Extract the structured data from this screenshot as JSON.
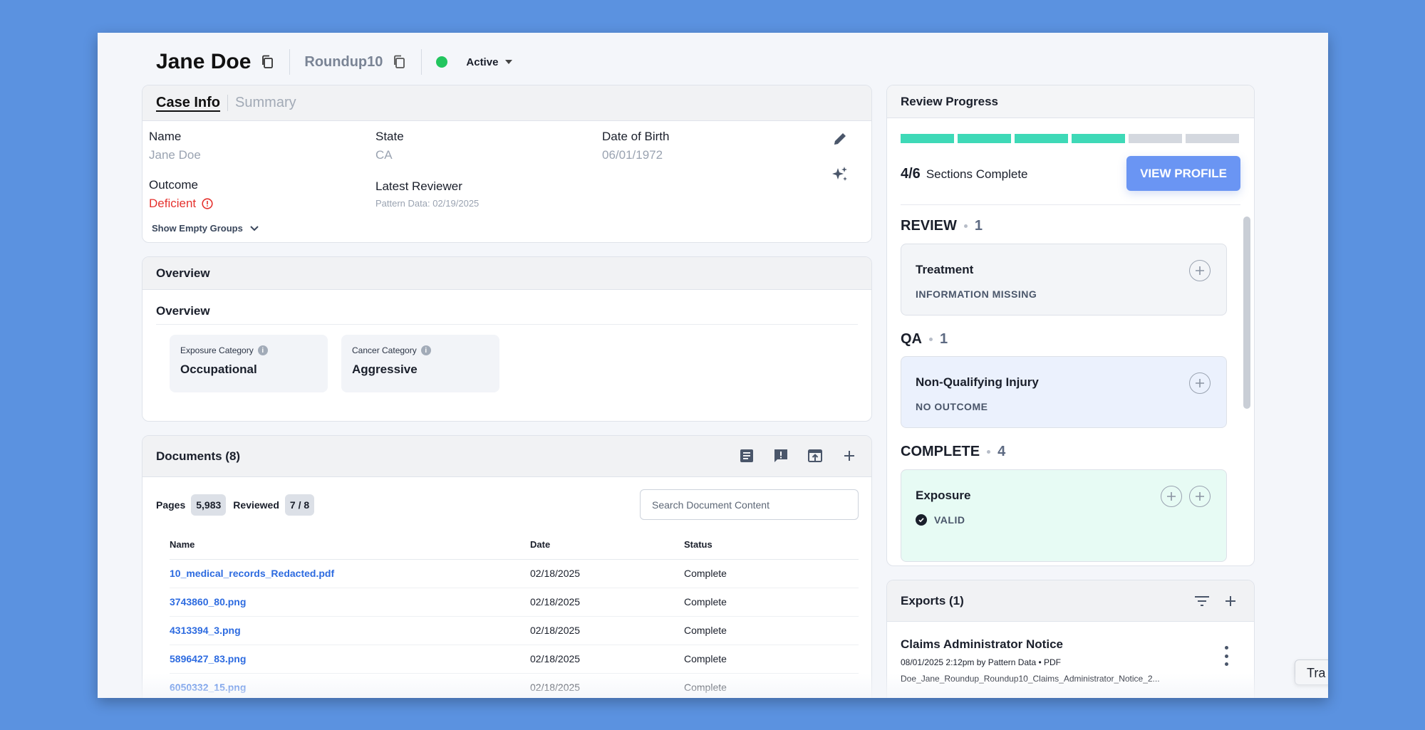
{
  "header": {
    "name": "Jane Doe",
    "project": "Roundup10",
    "status": "Active",
    "status_color": "#22c55e"
  },
  "case_info": {
    "tabs": [
      "Case Info",
      "Summary"
    ],
    "fields": {
      "name_label": "Name",
      "name_value": "Jane Doe",
      "state_label": "State",
      "state_value": "CA",
      "dob_label": "Date of Birth",
      "dob_value": "06/01/1972",
      "outcome_label": "Outcome",
      "outcome_value": "Deficient",
      "reviewer_label": "Latest Reviewer",
      "reviewer_value": "Pattern Data: 02/19/2025"
    },
    "show_empty": "Show Empty Groups"
  },
  "overview": {
    "title": "Overview",
    "subtitle": "Overview",
    "tiles": [
      {
        "label": "Exposure Category",
        "value": "Occupational"
      },
      {
        "label": "Cancer Category",
        "value": "Aggressive"
      }
    ]
  },
  "documents": {
    "title": "Documents (8)",
    "pages_label": "Pages",
    "pages_value": "5,983",
    "reviewed_label": "Reviewed",
    "reviewed_value": "7 / 8",
    "search_placeholder": "Search Document Content",
    "columns": [
      "Name",
      "Date",
      "Status"
    ],
    "rows": [
      {
        "name": "10_medical_records_Redacted.pdf",
        "date": "02/18/2025",
        "status": "Complete"
      },
      {
        "name": "3743860_80.png",
        "date": "02/18/2025",
        "status": "Complete"
      },
      {
        "name": "4313394_3.png",
        "date": "02/18/2025",
        "status": "Complete"
      },
      {
        "name": "5896427_83.png",
        "date": "02/18/2025",
        "status": "Complete"
      },
      {
        "name": "6050332_15.png",
        "date": "02/18/2025",
        "status": "Complete"
      }
    ]
  },
  "review_progress": {
    "title": "Review Progress",
    "completed": 4,
    "total": 6,
    "fraction_text": "4/6",
    "sections_text": "Sections Complete",
    "view_button": "VIEW PROFILE",
    "sections": [
      {
        "heading": "REVIEW",
        "count": "1",
        "item": "Treatment",
        "status": "INFORMATION MISSING"
      },
      {
        "heading": "QA",
        "count": "1",
        "item": "Non-Qualifying Injury",
        "status": "NO OUTCOME"
      },
      {
        "heading": "COMPLETE",
        "count": "4",
        "item": "Exposure",
        "status": "VALID"
      }
    ],
    "colors": {
      "done": "#3ed9b7",
      "todo": "#d4d8df"
    }
  },
  "exports": {
    "title": "Exports (1)",
    "item_title": "Claims Administrator Notice",
    "item_meta": "08/01/2025 2:12pm by Pattern Data • PDF",
    "item_file": "Doe_Jane_Roundup_Roundup10_Claims_Administrator_Notice_2..."
  },
  "tooltip": "Tra"
}
